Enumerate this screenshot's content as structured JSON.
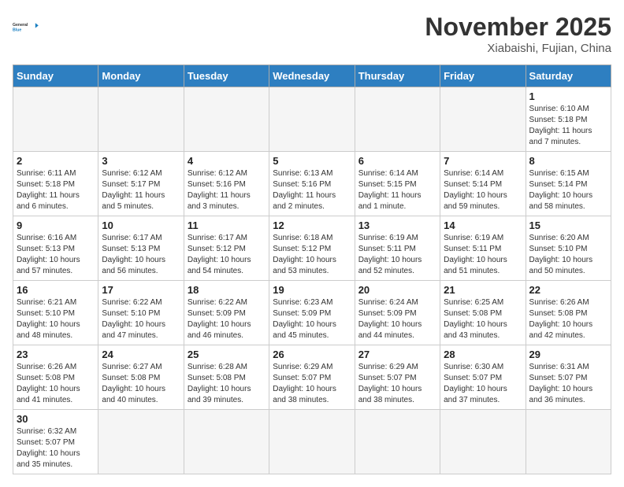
{
  "header": {
    "logo_general": "General",
    "logo_blue": "Blue",
    "month": "November 2025",
    "location": "Xiabaishi, Fujian, China"
  },
  "days_of_week": [
    "Sunday",
    "Monday",
    "Tuesday",
    "Wednesday",
    "Thursday",
    "Friday",
    "Saturday"
  ],
  "weeks": [
    [
      {
        "num": "",
        "info": ""
      },
      {
        "num": "",
        "info": ""
      },
      {
        "num": "",
        "info": ""
      },
      {
        "num": "",
        "info": ""
      },
      {
        "num": "",
        "info": ""
      },
      {
        "num": "",
        "info": ""
      },
      {
        "num": "1",
        "info": "Sunrise: 6:10 AM\nSunset: 5:18 PM\nDaylight: 11 hours\nand 7 minutes."
      }
    ],
    [
      {
        "num": "2",
        "info": "Sunrise: 6:11 AM\nSunset: 5:18 PM\nDaylight: 11 hours\nand 6 minutes."
      },
      {
        "num": "3",
        "info": "Sunrise: 6:12 AM\nSunset: 5:17 PM\nDaylight: 11 hours\nand 5 minutes."
      },
      {
        "num": "4",
        "info": "Sunrise: 6:12 AM\nSunset: 5:16 PM\nDaylight: 11 hours\nand 3 minutes."
      },
      {
        "num": "5",
        "info": "Sunrise: 6:13 AM\nSunset: 5:16 PM\nDaylight: 11 hours\nand 2 minutes."
      },
      {
        "num": "6",
        "info": "Sunrise: 6:14 AM\nSunset: 5:15 PM\nDaylight: 11 hours\nand 1 minute."
      },
      {
        "num": "7",
        "info": "Sunrise: 6:14 AM\nSunset: 5:14 PM\nDaylight: 10 hours\nand 59 minutes."
      },
      {
        "num": "8",
        "info": "Sunrise: 6:15 AM\nSunset: 5:14 PM\nDaylight: 10 hours\nand 58 minutes."
      }
    ],
    [
      {
        "num": "9",
        "info": "Sunrise: 6:16 AM\nSunset: 5:13 PM\nDaylight: 10 hours\nand 57 minutes."
      },
      {
        "num": "10",
        "info": "Sunrise: 6:17 AM\nSunset: 5:13 PM\nDaylight: 10 hours\nand 56 minutes."
      },
      {
        "num": "11",
        "info": "Sunrise: 6:17 AM\nSunset: 5:12 PM\nDaylight: 10 hours\nand 54 minutes."
      },
      {
        "num": "12",
        "info": "Sunrise: 6:18 AM\nSunset: 5:12 PM\nDaylight: 10 hours\nand 53 minutes."
      },
      {
        "num": "13",
        "info": "Sunrise: 6:19 AM\nSunset: 5:11 PM\nDaylight: 10 hours\nand 52 minutes."
      },
      {
        "num": "14",
        "info": "Sunrise: 6:19 AM\nSunset: 5:11 PM\nDaylight: 10 hours\nand 51 minutes."
      },
      {
        "num": "15",
        "info": "Sunrise: 6:20 AM\nSunset: 5:10 PM\nDaylight: 10 hours\nand 50 minutes."
      }
    ],
    [
      {
        "num": "16",
        "info": "Sunrise: 6:21 AM\nSunset: 5:10 PM\nDaylight: 10 hours\nand 48 minutes."
      },
      {
        "num": "17",
        "info": "Sunrise: 6:22 AM\nSunset: 5:10 PM\nDaylight: 10 hours\nand 47 minutes."
      },
      {
        "num": "18",
        "info": "Sunrise: 6:22 AM\nSunset: 5:09 PM\nDaylight: 10 hours\nand 46 minutes."
      },
      {
        "num": "19",
        "info": "Sunrise: 6:23 AM\nSunset: 5:09 PM\nDaylight: 10 hours\nand 45 minutes."
      },
      {
        "num": "20",
        "info": "Sunrise: 6:24 AM\nSunset: 5:09 PM\nDaylight: 10 hours\nand 44 minutes."
      },
      {
        "num": "21",
        "info": "Sunrise: 6:25 AM\nSunset: 5:08 PM\nDaylight: 10 hours\nand 43 minutes."
      },
      {
        "num": "22",
        "info": "Sunrise: 6:26 AM\nSunset: 5:08 PM\nDaylight: 10 hours\nand 42 minutes."
      }
    ],
    [
      {
        "num": "23",
        "info": "Sunrise: 6:26 AM\nSunset: 5:08 PM\nDaylight: 10 hours\nand 41 minutes."
      },
      {
        "num": "24",
        "info": "Sunrise: 6:27 AM\nSunset: 5:08 PM\nDaylight: 10 hours\nand 40 minutes."
      },
      {
        "num": "25",
        "info": "Sunrise: 6:28 AM\nSunset: 5:08 PM\nDaylight: 10 hours\nand 39 minutes."
      },
      {
        "num": "26",
        "info": "Sunrise: 6:29 AM\nSunset: 5:07 PM\nDaylight: 10 hours\nand 38 minutes."
      },
      {
        "num": "27",
        "info": "Sunrise: 6:29 AM\nSunset: 5:07 PM\nDaylight: 10 hours\nand 38 minutes."
      },
      {
        "num": "28",
        "info": "Sunrise: 6:30 AM\nSunset: 5:07 PM\nDaylight: 10 hours\nand 37 minutes."
      },
      {
        "num": "29",
        "info": "Sunrise: 6:31 AM\nSunset: 5:07 PM\nDaylight: 10 hours\nand 36 minutes."
      }
    ],
    [
      {
        "num": "30",
        "info": "Sunrise: 6:32 AM\nSunset: 5:07 PM\nDaylight: 10 hours\nand 35 minutes."
      },
      {
        "num": "",
        "info": ""
      },
      {
        "num": "",
        "info": ""
      },
      {
        "num": "",
        "info": ""
      },
      {
        "num": "",
        "info": ""
      },
      {
        "num": "",
        "info": ""
      },
      {
        "num": "",
        "info": ""
      }
    ]
  ]
}
